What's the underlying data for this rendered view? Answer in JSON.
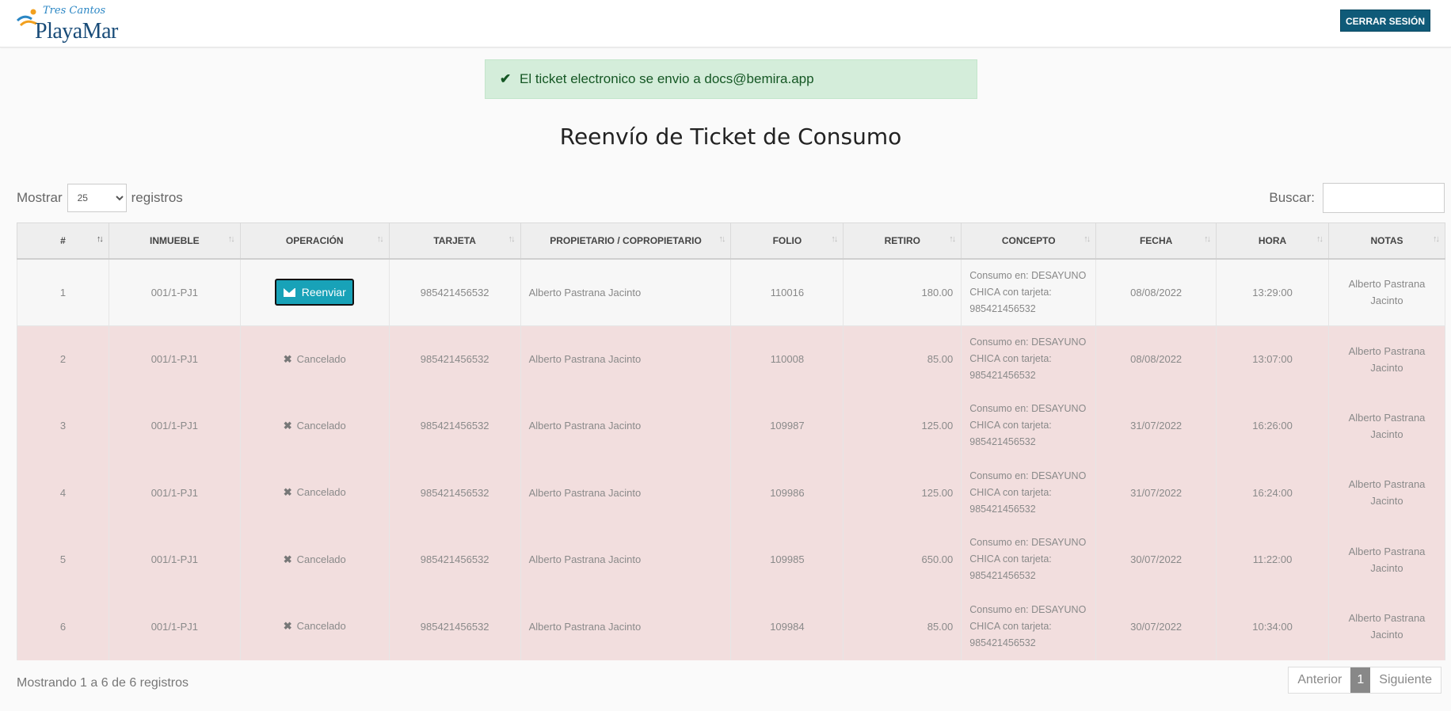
{
  "brand": {
    "top": "Tres Cantos",
    "main": "PlayaMar"
  },
  "header": {
    "logout_label": "CERRAR SESIÓN"
  },
  "alert": {
    "icon": "check-icon",
    "message": "El ticket electronico se envio a docs@bemira.app"
  },
  "page": {
    "title": "Reenvío de Ticket de Consumo"
  },
  "controls": {
    "show_label": "Mostrar",
    "page_size": "25",
    "records_label": "registros",
    "search_label": "Buscar:",
    "search_value": ""
  },
  "table": {
    "columns": [
      "#",
      "INMUEBLE",
      "OPERACIÓN",
      "TARJETA",
      "PROPIETARIO / COPROPIETARIO",
      "FOLIO",
      "RETIRO",
      "CONCEPTO",
      "FECHA",
      "HORA",
      "NOTAS"
    ],
    "rows": [
      {
        "num": "1",
        "inmueble": "001/1-PJ1",
        "operacion": "Reenviar",
        "tarjeta": "985421456532",
        "propietario": "Alberto Pastrana Jacinto",
        "folio": "110016",
        "retiro": "180.00",
        "concepto": [
          "Consumo en: DESAYUNO",
          "CHICA con tarjeta:",
          "985421456532"
        ],
        "fecha": "08/08/2022",
        "hora": "13:29:00",
        "notas": [
          "Alberto Pastrana",
          "Jacinto"
        ]
      },
      {
        "num": "2",
        "inmueble": "001/1-PJ1",
        "operacion": "Cancelado",
        "tarjeta": "985421456532",
        "propietario": "Alberto Pastrana Jacinto",
        "folio": "110008",
        "retiro": "85.00",
        "concepto": [
          "Consumo en: DESAYUNO",
          "CHICA con tarjeta:",
          "985421456532"
        ],
        "fecha": "08/08/2022",
        "hora": "13:07:00",
        "notas": [
          "Alberto Pastrana",
          "Jacinto"
        ]
      },
      {
        "num": "3",
        "inmueble": "001/1-PJ1",
        "operacion": "Cancelado",
        "tarjeta": "985421456532",
        "propietario": "Alberto Pastrana Jacinto",
        "folio": "109987",
        "retiro": "125.00",
        "concepto": [
          "Consumo en: DESAYUNO",
          "CHICA con tarjeta:",
          "985421456532"
        ],
        "fecha": "31/07/2022",
        "hora": "16:26:00",
        "notas": [
          "Alberto Pastrana",
          "Jacinto"
        ]
      },
      {
        "num": "4",
        "inmueble": "001/1-PJ1",
        "operacion": "Cancelado",
        "tarjeta": "985421456532",
        "propietario": "Alberto Pastrana Jacinto",
        "folio": "109986",
        "retiro": "125.00",
        "concepto": [
          "Consumo en: DESAYUNO",
          "CHICA con tarjeta:",
          "985421456532"
        ],
        "fecha": "31/07/2022",
        "hora": "16:24:00",
        "notas": [
          "Alberto Pastrana",
          "Jacinto"
        ]
      },
      {
        "num": "5",
        "inmueble": "001/1-PJ1",
        "operacion": "Cancelado",
        "tarjeta": "985421456532",
        "propietario": "Alberto Pastrana Jacinto",
        "folio": "109985",
        "retiro": "650.00",
        "concepto": [
          "Consumo en: DESAYUNO",
          "CHICA con tarjeta:",
          "985421456532"
        ],
        "fecha": "30/07/2022",
        "hora": "11:22:00",
        "notas": [
          "Alberto Pastrana",
          "Jacinto"
        ]
      },
      {
        "num": "6",
        "inmueble": "001/1-PJ1",
        "operacion": "Cancelado",
        "tarjeta": "985421456532",
        "propietario": "Alberto Pastrana Jacinto",
        "folio": "109984",
        "retiro": "85.00",
        "concepto": [
          "Consumo en: DESAYUNO",
          "CHICA con tarjeta:",
          "985421456532"
        ],
        "fecha": "30/07/2022",
        "hora": "10:34:00",
        "notas": [
          "Alberto Pastrana",
          "Jacinto"
        ]
      }
    ]
  },
  "footer": {
    "info": "Mostrando 1 a 6 de 6 registros",
    "prev": "Anterior",
    "page": "1",
    "next": "Siguiente"
  }
}
